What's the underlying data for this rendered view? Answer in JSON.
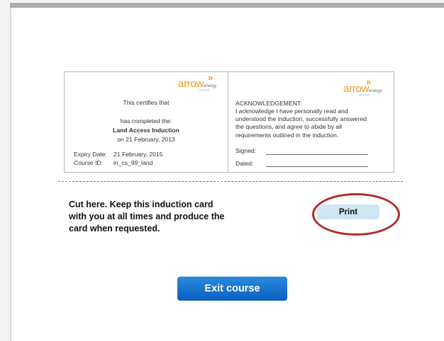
{
  "card": {
    "logo": {
      "word": "arrow",
      "suffix": "energy",
      "tagline": "gas forever"
    },
    "left": {
      "certifies": "This certifies that",
      "completed": "has completed the:",
      "course_name": "Land Access Induction",
      "completion_date": "on 21 February, 2013",
      "expiry_label": "Expiry Date:",
      "expiry_value": "21 February, 2015",
      "course_id_label": "Course ID:",
      "course_id_value": "in_cs_99_land"
    },
    "right": {
      "heading": "ACKNOWLEDGEMENT:",
      "line1": "I acknowledge I have personally read and",
      "line2": "understood the induction, successfully answered",
      "line3": "the questions, and agree to abide by all",
      "line4": "requirements outlined in the induction.",
      "signed_label": "Signed:",
      "dated_label": "Dated:"
    }
  },
  "cut": {
    "line1": "Cut here. Keep this induction card",
    "line2": "with you at all times and produce the",
    "line3": "card when requested."
  },
  "buttons": {
    "print": "Print",
    "exit": "Exit course"
  },
  "colors": {
    "brand_orange": "#f59b24",
    "annotation_red": "#b22a2a",
    "exit_blue": "#1575d2",
    "print_bg": "#cfe6f3"
  }
}
